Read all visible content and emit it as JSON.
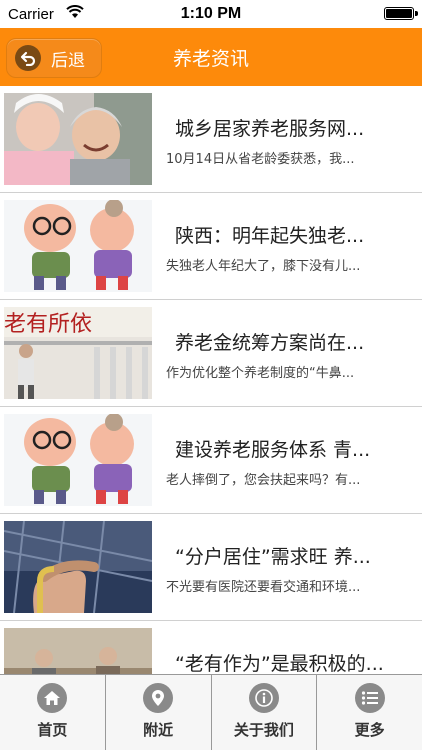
{
  "status_bar": {
    "carrier": "Carrier",
    "time": "1:10 PM",
    "battery_level": 1.0
  },
  "nav": {
    "back_label": "后退",
    "title": "养老资讯"
  },
  "news": [
    {
      "title": "城乡居家养老服务网...",
      "desc": "10月14日从省老龄委获悉，我...",
      "image": "nurse-with-elderly-woman"
    },
    {
      "title": "陕西：明年起失独老...",
      "desc": "失独老人年纪大了，膝下没有儿...",
      "image": "cartoon-elderly-couple"
    },
    {
      "title": "养老金统筹方案尚在...",
      "desc": "作为优化整个养老制度的“牛鼻...",
      "image": "elderly-man-walking"
    },
    {
      "title": "建设养老服务体系 青...",
      "desc": "老人摔倒了，您会扶起来吗？有...",
      "image": "cartoon-elderly-couple"
    },
    {
      "title": "“分户居住”需求旺 养...",
      "desc": "不光要有医院还要看交通和环境...",
      "image": "hands-on-cane"
    },
    {
      "title": "“老有作为”是最积极的...",
      "desc": "",
      "image": "elderly-people-outdoors"
    }
  ],
  "tabs": [
    {
      "label": "首页",
      "icon": "home-icon"
    },
    {
      "label": "附近",
      "icon": "location-pin-icon"
    },
    {
      "label": "关于我们",
      "icon": "info-icon"
    },
    {
      "label": "更多",
      "icon": "more-list-icon"
    }
  ],
  "colors": {
    "nav_background": "#fd8a0b",
    "tab_icon": "#8a8a8a"
  }
}
